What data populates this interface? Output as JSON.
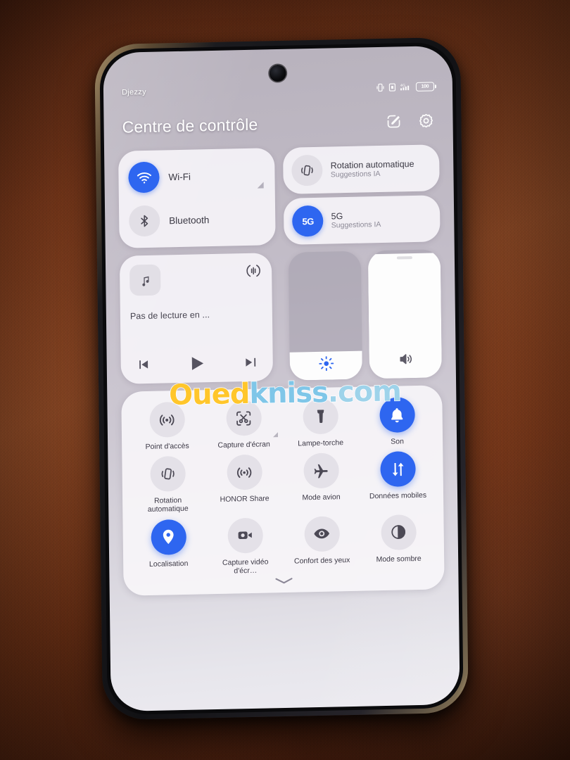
{
  "status_bar": {
    "carrier": "Djezzy",
    "battery_level": "100",
    "icons": [
      "vibrate-icon",
      "sim-icon",
      "signal-4g-icon",
      "battery-icon"
    ]
  },
  "header": {
    "title": "Centre de contrôle",
    "edit_icon": "edit-square-icon",
    "settings_icon": "gear-icon"
  },
  "connectivity": {
    "wifi": {
      "label": "Wi-Fi",
      "icon": "wifi-icon",
      "active": true
    },
    "bluetooth": {
      "label": "Bluetooth",
      "icon": "bluetooth-icon",
      "active": false
    },
    "expander_icon": "expand-triangle-icon"
  },
  "network_card": {
    "rotation": {
      "title": "Rotation automatique",
      "subtitle": "Suggestions IA",
      "icon": "auto-rotate-icon",
      "active": false
    },
    "fiveg": {
      "title": "5G",
      "subtitle": "Suggestions IA",
      "icon": "5g-badge",
      "badge": "5G",
      "active": true
    }
  },
  "media": {
    "title": "Pas de lecture en ...",
    "album_icon": "music-note-icon",
    "cast_icon": "cast-audio-icon",
    "controls": [
      {
        "name": "previous-track-button",
        "icon": "skip-previous-icon"
      },
      {
        "name": "play-button",
        "icon": "play-icon"
      },
      {
        "name": "next-track-button",
        "icon": "skip-next-icon"
      }
    ]
  },
  "sliders": {
    "brightness": {
      "name": "brightness-slider",
      "icon": "brightness-icon",
      "value": 22
    },
    "volume": {
      "name": "volume-slider",
      "icon": "volume-icon",
      "value": 97
    }
  },
  "toggles": [
    {
      "label": "Point d'accès",
      "icon": "hotspot-icon",
      "active": false,
      "expandable": false
    },
    {
      "label": "Capture d'écran",
      "icon": "screenshot-icon",
      "active": false,
      "expandable": true
    },
    {
      "label": "Lampe-torche",
      "icon": "flashlight-icon",
      "active": false,
      "expandable": false
    },
    {
      "label": "Son",
      "icon": "bell-icon",
      "active": true,
      "expandable": false
    },
    {
      "label": "Rotation automatique",
      "icon": "auto-rotate-icon",
      "active": false,
      "expandable": false
    },
    {
      "label": "HONOR Share",
      "icon": "honor-share-icon",
      "active": false,
      "expandable": false
    },
    {
      "label": "Mode avion",
      "icon": "airplane-icon",
      "active": false,
      "expandable": false
    },
    {
      "label": "Données mobiles",
      "icon": "mobile-data-icon",
      "active": true,
      "expandable": false
    },
    {
      "label": "Localisation",
      "icon": "location-pin-icon",
      "active": true,
      "expandable": false
    },
    {
      "label": "Capture vidéo d'écr…",
      "icon": "screen-record-icon",
      "active": false,
      "expandable": false
    },
    {
      "label": "Confort des yeux",
      "icon": "eye-comfort-icon",
      "active": false,
      "expandable": false
    },
    {
      "label": "Mode sombre",
      "icon": "dark-mode-icon",
      "active": false,
      "expandable": false
    }
  ],
  "footer": {
    "collapse_icon": "chevron-down-icon"
  },
  "watermark": {
    "part1": "Oued",
    "part2": "kniss",
    "part3": ".com"
  },
  "colors": {
    "accent_blue": "#2e66f0",
    "tile_inactive": "#e4e1e8",
    "card_bg": "#f8f6fa",
    "text_primary": "#3c3946",
    "text_secondary": "#8d8a97",
    "background_fabric": "#8d4a26",
    "watermark_yellow": "#ffc62b",
    "watermark_blue": "#7fc6e8"
  }
}
